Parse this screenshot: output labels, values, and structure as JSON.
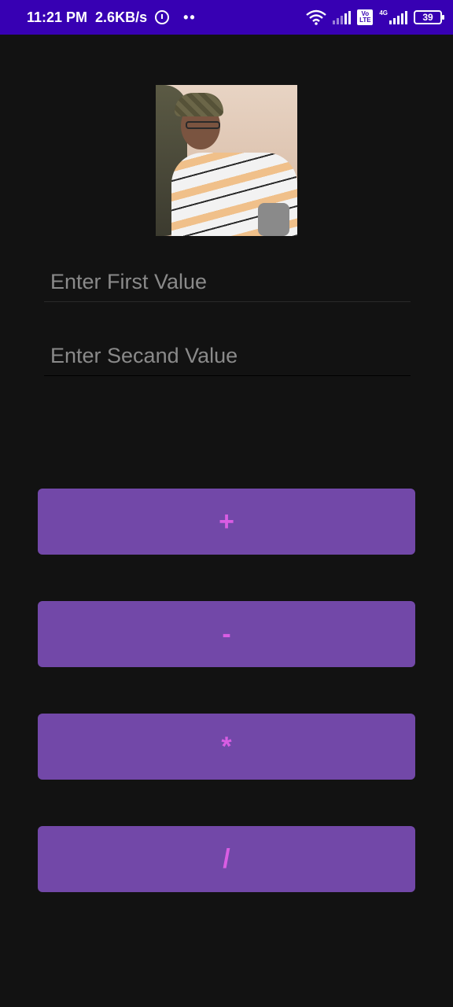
{
  "status_bar": {
    "time": "11:21 PM",
    "speed": "2.6KB/s",
    "dots": "••",
    "volte_top": "Vo",
    "volte_bottom": "LTE",
    "network": "4G",
    "battery": "39",
    "background_color": "#3700b3"
  },
  "profile": {
    "image_description": "photo"
  },
  "inputs": {
    "first_placeholder": "Enter First Value",
    "first_value": "",
    "second_placeholder": "Enter Secand Value",
    "second_value": ""
  },
  "buttons": {
    "add_label": "+",
    "subtract_label": "-",
    "multiply_label": "*",
    "divide_label": "/",
    "button_color": "#7248a8",
    "label_color": "#d95de3"
  },
  "theme": {
    "background": "#121212"
  }
}
